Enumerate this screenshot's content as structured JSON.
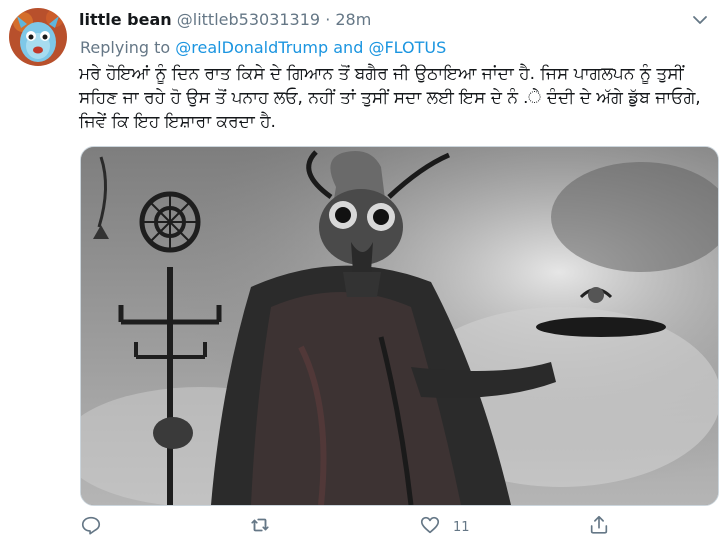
{
  "tweet": {
    "display_name": "little bean",
    "handle": "@littleb53031319",
    "separator": "·",
    "time": "28m",
    "replying_prefix": "Replying to",
    "mention_1": "@realDonaldTrump",
    "and_word": "and",
    "mention_2": "@FLOTUS",
    "text": "ਮਰੇ ਹੋਇਆਂ ਨੂੰ ਦਿਨ ਰਾਤ ਕਿਸੇ ਦੇ ਗਿਆਨ ਤੋਂ ਬਗੈਰ ਜੀ ਉਠਾਇਆ ਜਾਂਦਾ ਹੈ. ਜਿਸ ਪਾਗਲਪਨ ਨੂੰ ਤੁਸੀਂ ਸਹਿਣ ਜਾ ਰਹੇ ਹੋ ਉਸ ਤੋਂ ਪਨਾਹ ਲਓ, ਨਹੀਂ ਤਾਂ ਤੁਸੀਂ ਸਦਾ ਲਈ ਇਸ ਦੇ ਨੰ .ੇ ਦੰਦੀ ਦੇ ਅੱਗੇ ਡੁੱਬ ਜਾਓਗੇ, ਜਿਵੇਂ ਕਿ ਇਹ ਇਸ਼ਾਰਾ ਕਰਦਾ ਹੈ."
  },
  "actions": {
    "reply_count": "",
    "retweet_count": "",
    "like_count": "11"
  },
  "icons": {
    "avatar": "blue-creature-avatar",
    "more": "chevron-down-icon",
    "reply": "reply-icon",
    "retweet": "retweet-icon",
    "like": "heart-icon",
    "share": "share-icon"
  },
  "colors": {
    "link": "#1b95e0",
    "secondary_text": "#657786",
    "border": "#ccd6dd"
  }
}
